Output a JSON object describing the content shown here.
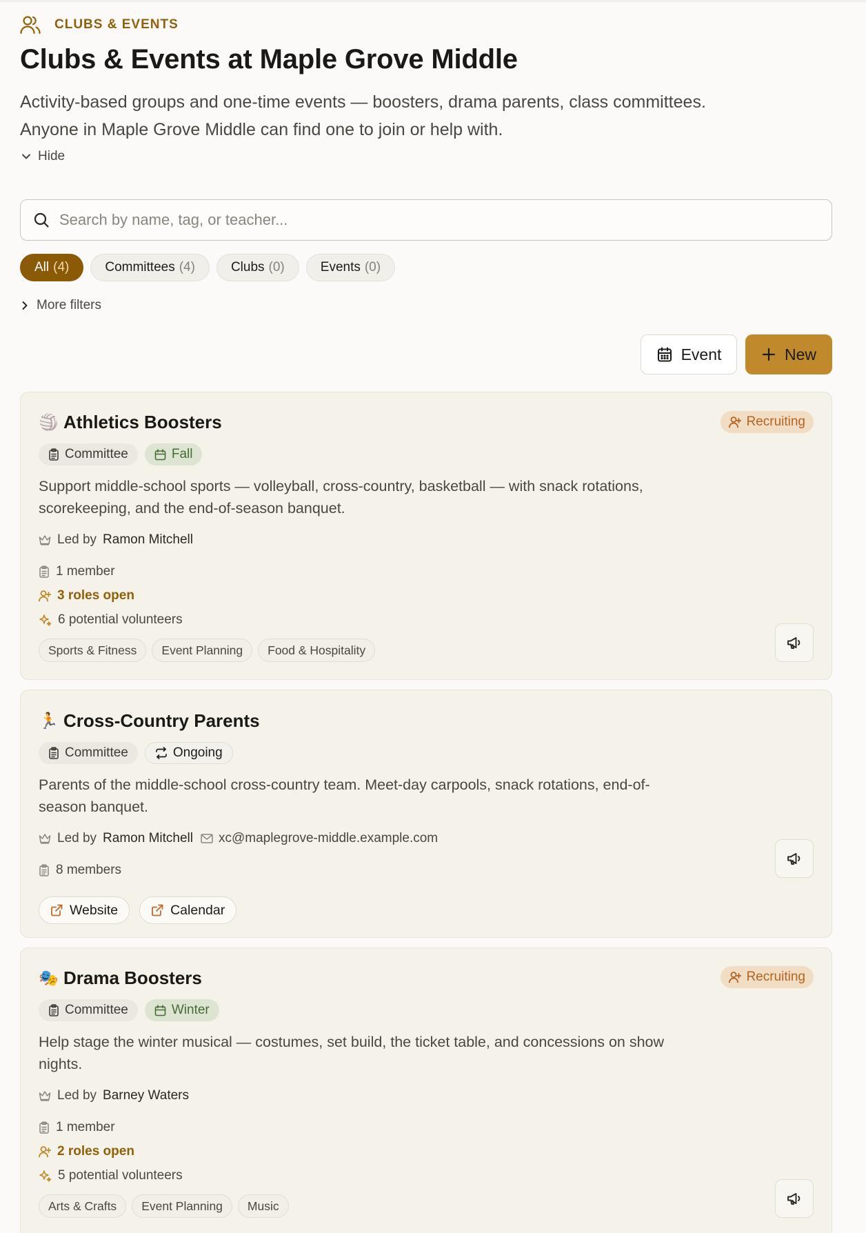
{
  "header": {
    "eyebrow": "CLUBS & EVENTS",
    "title": "Clubs & Events at Maple Grove Middle",
    "description": "Activity-based groups and one-time events — boosters, drama parents, class committees. Anyone in Maple Grove Middle can find one to join or help with.",
    "hide_label": "Hide"
  },
  "search": {
    "placeholder": "Search by name, tag, or teacher..."
  },
  "filters": [
    {
      "label": "All",
      "count": "(4)",
      "active": true
    },
    {
      "label": "Committees",
      "count": "(4)",
      "active": false
    },
    {
      "label": "Clubs",
      "count": "(0)",
      "active": false
    },
    {
      "label": "Events",
      "count": "(0)",
      "active": false
    }
  ],
  "more_filters_label": "More filters",
  "actions": {
    "event_label": "Event",
    "new_label": "New"
  },
  "colors": {
    "accent": "#8a5a06",
    "primary_button": "#c08a2c",
    "card_bg": "#f5f2ea",
    "recruiting_bg": "#f1dcc4",
    "season_bg": "#dde5d2"
  },
  "cards": [
    {
      "emoji": "🏐",
      "name": "Athletics Boosters",
      "status": "Recruiting",
      "type": "Committee",
      "season": "Fall",
      "description": "Support middle-school sports — volleyball, cross-country, basketball — with snack rotations, scorekeeping, and the end-of-season banquet.",
      "led_prefix": "Led by",
      "leader": "Ramon Mitchell",
      "members": "1 member",
      "roles_open": "3 roles open",
      "volunteers": "6 potential volunteers",
      "tags": [
        "Sports & Fitness",
        "Event Planning",
        "Food & Hospitality"
      ]
    },
    {
      "emoji": "🏃",
      "name": "Cross-Country Parents",
      "type": "Committee",
      "cadence": "Ongoing",
      "description": "Parents of the middle-school cross-country team. Meet-day carpools, snack rotations, end-of-season banquet.",
      "led_prefix": "Led by",
      "leader": "Ramon Mitchell",
      "email": "xc@maplegrove-middle.example.com",
      "members": "8 members",
      "links": [
        "Website",
        "Calendar"
      ]
    },
    {
      "emoji": "🎭",
      "name": "Drama Boosters",
      "status": "Recruiting",
      "type": "Committee",
      "season": "Winter",
      "description": "Help stage the winter musical — costumes, set build, the ticket table, and concessions on show nights.",
      "led_prefix": "Led by",
      "leader": "Barney Waters",
      "members": "1 member",
      "roles_open": "2 roles open",
      "volunteers": "5 potential volunteers",
      "tags": [
        "Arts & Crafts",
        "Event Planning",
        "Music"
      ]
    }
  ]
}
